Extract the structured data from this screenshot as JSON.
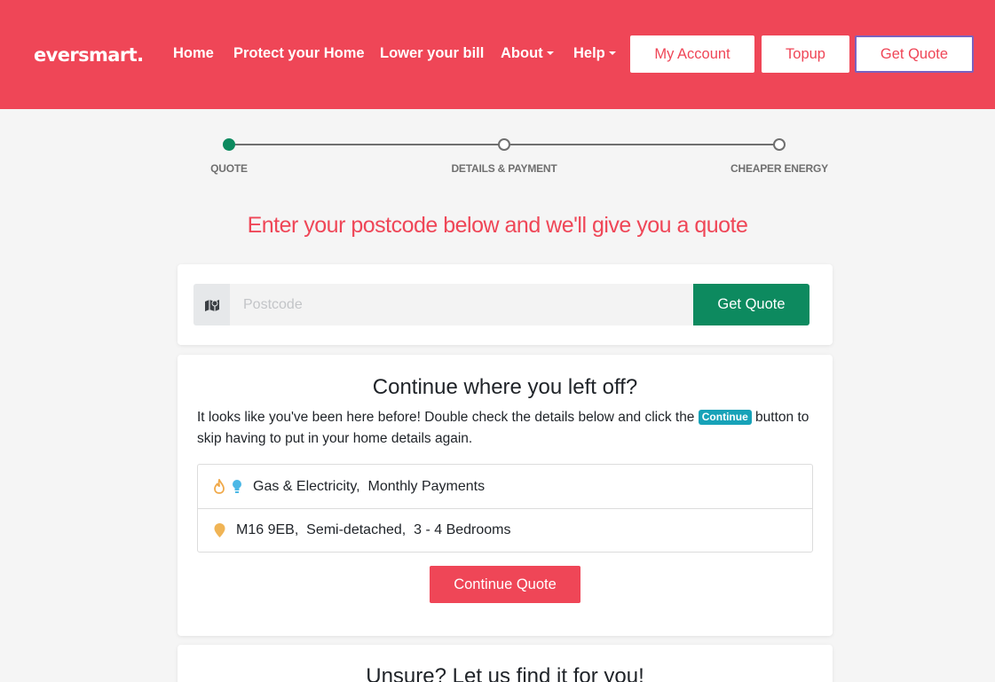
{
  "brand": {
    "logo_text": "eversmart.",
    "primary_color": "#ef4657",
    "accent_green": "#0d8a5f"
  },
  "nav": {
    "items": [
      {
        "label": "Home",
        "has_caret": false
      },
      {
        "label": "Protect your Home",
        "has_caret": false
      },
      {
        "label": "Lower your bill",
        "has_caret": false
      },
      {
        "label": "About",
        "has_caret": true
      },
      {
        "label": "Help",
        "has_caret": true
      }
    ],
    "my_account_label": "My Account",
    "topup_label": "Topup",
    "get_quote_label": "Get Quote"
  },
  "stepper": {
    "steps": [
      {
        "label": "QUOTE",
        "active": true
      },
      {
        "label": "DETAILS & PAYMENT",
        "active": false
      },
      {
        "label": "CHEAPER ENERGY",
        "active": false
      }
    ]
  },
  "headline": "Enter your postcode below and we'll give you a quote",
  "postcode": {
    "icon": "map-icon",
    "placeholder": "Postcode",
    "value": "",
    "button_label": "Get Quote"
  },
  "continue_section": {
    "title": "Continue where you left off?",
    "body_before": "It looks like you've been here before! Double check the details below and click the ",
    "badge_label": "Continue",
    "body_after": " button to skip having to put in your home details again.",
    "rows": [
      {
        "icons": [
          "flame-icon",
          "lightbulb-icon"
        ],
        "text": "Gas & Electricity,  Monthly Payments"
      },
      {
        "icons": [
          "map-pin-icon"
        ],
        "text": "M16 9EB,  Semi-detached,  3 - 4 Bedrooms"
      }
    ],
    "button_label": "Continue Quote"
  },
  "unsure_section": {
    "title": "Unsure? Let us find it for you!"
  }
}
